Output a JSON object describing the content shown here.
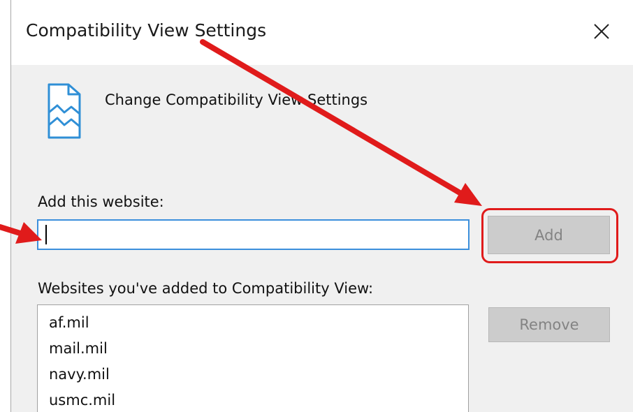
{
  "dialog": {
    "title": "Compatibility View Settings",
    "close_icon": "close-icon"
  },
  "header": {
    "icon": "compatibility-view-icon",
    "text": "Change Compatibility View Settings"
  },
  "add_section": {
    "label": "Add this website:",
    "input_value": "",
    "add_button": "Add"
  },
  "list_section": {
    "label": "Websites you've added to Compatibility View:",
    "items": [
      "af.mil",
      "mail.mil",
      "navy.mil",
      "usmc.mil"
    ],
    "remove_button": "Remove"
  },
  "annotation": {
    "color": "#e01b1b"
  }
}
